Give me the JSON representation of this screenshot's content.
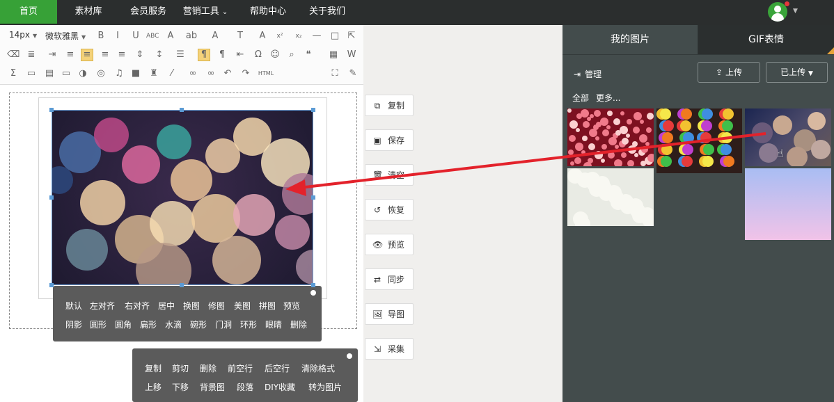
{
  "nav": {
    "items": [
      "首页",
      "素材库",
      "会员服务",
      "营销工具",
      "帮助中心",
      "关于我们"
    ],
    "dropdown_caret": "⌄"
  },
  "toolbar": {
    "font_size": "14px",
    "font_family": "微软雅黑",
    "icons_row1": [
      "bold-icon",
      "italic-icon",
      "underline-icon",
      "strikethrough-icon",
      "font-color-icon",
      "highlight-icon",
      "text-border-icon",
      "text-transform-icon",
      "font-scale-icon",
      "superscript-icon",
      "subscript-icon",
      "horizontal-rule-icon",
      "blank-page-icon",
      "export-icon"
    ],
    "icons_row2": [
      "eraser-icon",
      "format-select-icon",
      "indent-icon",
      "align-left-icon",
      "align-center-icon",
      "align-right-icon",
      "justify-icon",
      "line-spacing-icon",
      "paragraph-spacing-icon",
      "list-style-icon",
      "ltr-icon",
      "rtl-icon",
      "text-indent-icon",
      "omega-icon",
      "emoji-icon",
      "find-icon",
      "quote-icon",
      "table-icon",
      "word-icon"
    ],
    "icons_row3": [
      "sum-icon",
      "image-icon",
      "multi-image-icon",
      "video-icon",
      "palette-icon",
      "map-icon",
      "music-icon",
      "camera-icon",
      "stamp-icon",
      "magic-wand-icon",
      "link-icon",
      "unlink-icon",
      "undo-icon",
      "redo-icon",
      "html-icon",
      "fullscreen-icon",
      "edit-icon"
    ],
    "html_label": "HTML"
  },
  "image_popup": {
    "row1": [
      "默认",
      "左对齐",
      "右对齐",
      "居中",
      "换图",
      "修图",
      "美图",
      "拼图",
      "预览"
    ],
    "row2": [
      "阴影",
      "圆形",
      "圆角",
      "扁形",
      "水滴",
      "碗形",
      "门洞",
      "环形",
      "眼睛",
      "删除"
    ]
  },
  "text_popup": {
    "row1": [
      "复制",
      "剪切",
      "删除",
      "前空行",
      "后空行",
      "清除格式"
    ],
    "row2": [
      "上移",
      "下移",
      "背景图",
      "段落",
      "DIY收藏",
      "转为图片"
    ]
  },
  "side_buttons": [
    {
      "label": "复制",
      "icon": "copy-icon",
      "glyph": "⧉"
    },
    {
      "label": "保存",
      "icon": "save-icon",
      "glyph": "▣"
    },
    {
      "label": "清空",
      "icon": "trash-icon",
      "glyph": "🗑"
    },
    {
      "label": "恢复",
      "icon": "restore-icon",
      "glyph": "↺"
    },
    {
      "label": "预览",
      "icon": "eye-icon",
      "glyph": "👁"
    },
    {
      "label": "同步",
      "icon": "sync-icon",
      "glyph": "⇄"
    },
    {
      "label": "导图",
      "icon": "import-image-icon",
      "glyph": "🖼"
    },
    {
      "label": "采集",
      "icon": "collect-icon",
      "glyph": "⇲"
    }
  ],
  "panel": {
    "tab_active": "我的图片",
    "tab_other": "GIF表情",
    "manage_label": "管理",
    "upload_label": "上传",
    "uploaded_label": "已上传",
    "filter_all": "全部",
    "filter_more": "更多..."
  },
  "colors": {
    "nav_bg": "#2b2e2e",
    "nav_active": "#37a137",
    "panel_bg": "#434c4c",
    "popup_bg": "#5b5b5b",
    "arrow": "#e3222b",
    "selection": "#5b9bd5"
  }
}
